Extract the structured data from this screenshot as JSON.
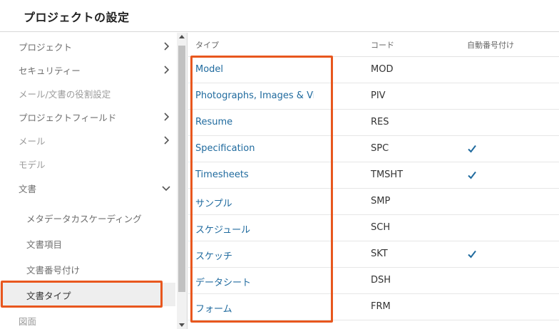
{
  "page_title": "プロジェクトの設定",
  "accent_color": "#e8571e",
  "link_color": "#1f6a9e",
  "check_color": "#1f6a9e",
  "sidebar": {
    "items": [
      {
        "label": "プロジェクト",
        "state": "enabled",
        "icon": "chevron-right-icon"
      },
      {
        "label": "セキュリティー",
        "state": "enabled",
        "icon": "chevron-right-icon"
      },
      {
        "label": "メール/文書の役割設定",
        "state": "disabled",
        "icon": null
      },
      {
        "label": "プロジェクトフィールド",
        "state": "enabled",
        "icon": "chevron-right-icon"
      },
      {
        "label": "メール",
        "state": "disabled",
        "icon": "chevron-right-icon"
      },
      {
        "label": "モデル",
        "state": "disabled",
        "icon": null
      },
      {
        "label": "文書",
        "state": "enabled",
        "icon": "chevron-down-icon"
      },
      {
        "label": "メタデータカスケーディング",
        "state": "enabled",
        "icon": null,
        "sub": true
      },
      {
        "label": "文書項目",
        "state": "enabled",
        "icon": null,
        "sub": true
      },
      {
        "label": "文書番号付け",
        "state": "enabled",
        "icon": null,
        "sub": true
      },
      {
        "label": "文書タイプ",
        "state": "selected",
        "icon": null,
        "sub": true
      },
      {
        "label": "図面",
        "state": "disabled",
        "icon": null
      }
    ]
  },
  "table": {
    "columns": {
      "type": "タイプ",
      "code": "コード",
      "auto_numbering": "自動番号付け"
    },
    "rows": [
      {
        "type": "Model",
        "code": "MOD",
        "auto_numbering": false
      },
      {
        "type": "Photographs, Images & Videos",
        "code": "PIV",
        "auto_numbering": false
      },
      {
        "type": "Resume",
        "code": "RES",
        "auto_numbering": false
      },
      {
        "type": "Specification",
        "code": "SPC",
        "auto_numbering": true
      },
      {
        "type": "Timesheets",
        "code": "TMSHT",
        "auto_numbering": true
      },
      {
        "type": "サンプル",
        "code": "SMP",
        "auto_numbering": false
      },
      {
        "type": "スケジュール",
        "code": "SCH",
        "auto_numbering": false
      },
      {
        "type": "スケッチ",
        "code": "SKT",
        "auto_numbering": true
      },
      {
        "type": "データシート",
        "code": "DSH",
        "auto_numbering": false
      },
      {
        "type": "フォーム",
        "code": "FRM",
        "auto_numbering": false
      }
    ]
  }
}
